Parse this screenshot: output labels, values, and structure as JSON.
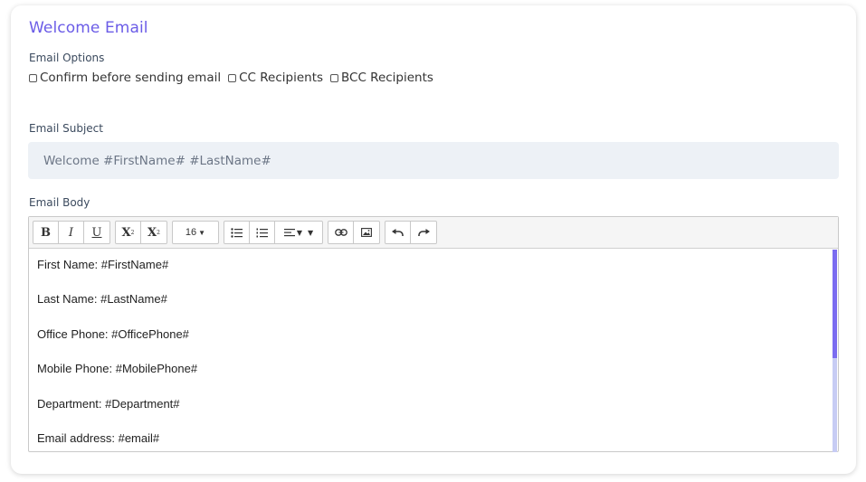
{
  "title": "Welcome Email",
  "email_options": {
    "label": "Email Options",
    "items": [
      {
        "label": "Confirm before sending email",
        "checked": false
      },
      {
        "label": "CC Recipients",
        "checked": false
      },
      {
        "label": "BCC Recipients",
        "checked": false
      }
    ]
  },
  "subject": {
    "label": "Email Subject",
    "value": "Welcome #FirstName# #LastName#"
  },
  "body": {
    "label": "Email Body",
    "toolbar": {
      "bold": "B",
      "italic": "I",
      "underline": "U",
      "superscript": "X",
      "subscript": "X",
      "font_size": "16"
    },
    "lines": [
      "First Name: #FirstName#",
      "Last Name: #LastName#",
      "Office Phone: #OfficePhone#",
      "Mobile Phone: #MobilePhone#",
      "Department: #Department#",
      "Email address: #email#"
    ]
  },
  "colors": {
    "accent": "#6b5ce7",
    "subject_bg": "#edf1f6",
    "scroll_thumb": "#7b6cf0"
  }
}
